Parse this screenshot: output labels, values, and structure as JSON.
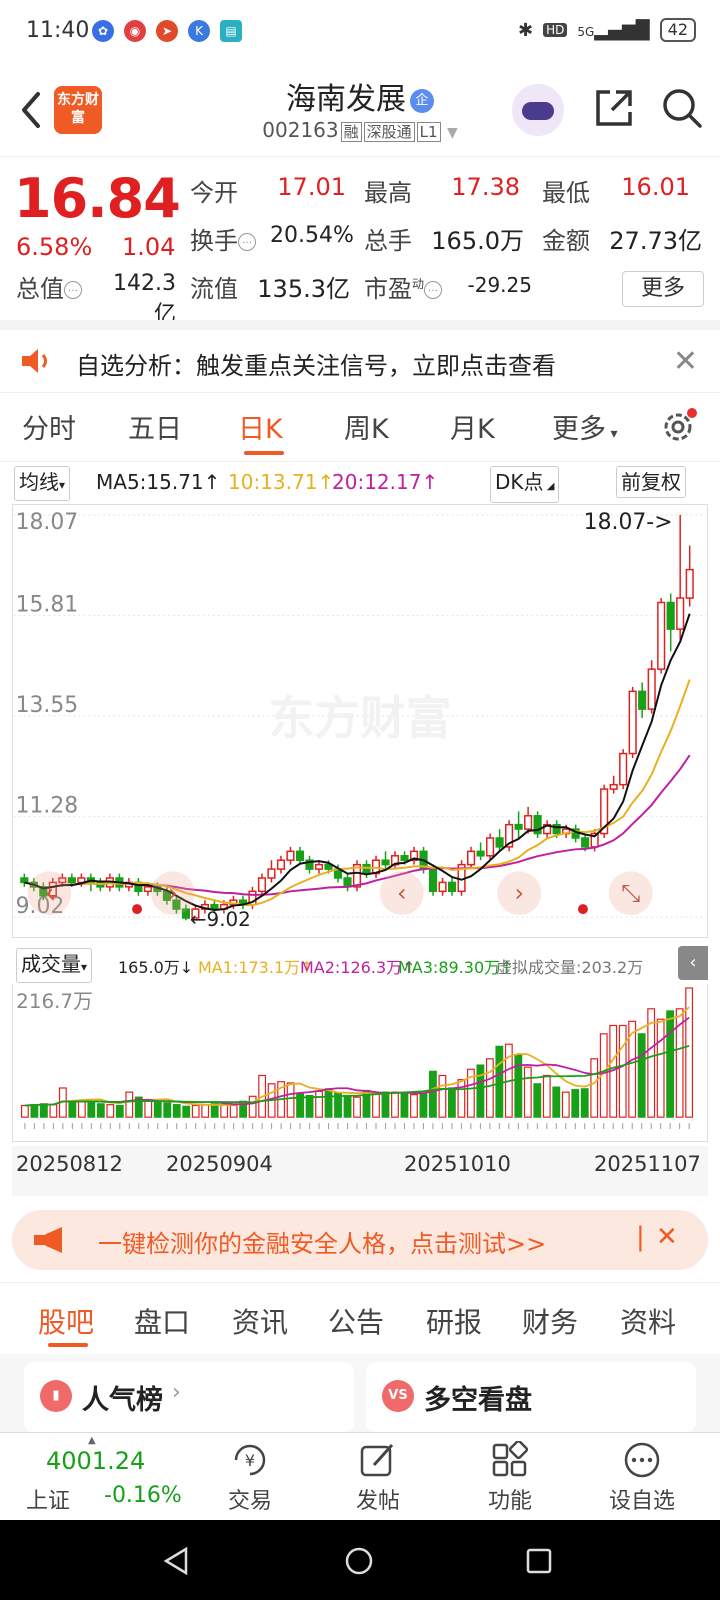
{
  "status": {
    "time": "11:40",
    "battery": "42",
    "network": "5G"
  },
  "header": {
    "title": "海南发展",
    "title_badge": "企",
    "code": "002163",
    "tags": [
      "融",
      "深股通",
      "L1"
    ],
    "logo_text": "东方财富"
  },
  "quote": {
    "price": "16.84",
    "pct": "6.58%",
    "change": "1.04",
    "open_label": "今开",
    "open": "17.01",
    "high_label": "最高",
    "high": "17.38",
    "low_label": "最低",
    "low": "16.01",
    "turnover_label": "换手",
    "turnover": "20.54%",
    "volume_label": "总手",
    "volume": "165.0万",
    "amount_label": "金额",
    "amount": "27.73亿",
    "mktcap_label": "总值",
    "mktcap": "142.3亿",
    "float_label": "流值",
    "float_cap": "135.3亿",
    "pe_label": "市盈",
    "pe_sup": "动",
    "pe": "-29.25",
    "more": "更多"
  },
  "notice": {
    "text": "自选分析：触发重点关注信号，立即点击查看"
  },
  "tabs": [
    "分时",
    "五日",
    "日K",
    "周K",
    "月K",
    "更多"
  ],
  "active_tab": "日K",
  "chart_toolbar": {
    "ma_select": "均线",
    "ma5": "MA5:15.71↑",
    "ma10": "10:13.71↑",
    "ma20": "20:12.17↑",
    "dk": "DK点",
    "adjust": "前复权"
  },
  "chart_data": {
    "type": "candlestick",
    "y_ticks": [
      "18.07",
      "15.81",
      "13.55",
      "11.28",
      "9.02"
    ],
    "ylim": [
      9.02,
      18.07
    ],
    "high_marker": "18.07->",
    "low_marker": "9.02",
    "watermark": "东方财富",
    "x_labels": [
      "20250812",
      "20250904",
      "20251010",
      "20251107"
    ],
    "colors": {
      "up": "#e02020",
      "down": "#18a018",
      "ma5": "#111111",
      "ma10": "#e8b020",
      "ma20": "#c020a0"
    },
    "candles": [
      [
        9.9,
        9.8,
        10.0,
        9.7
      ],
      [
        9.8,
        9.7,
        9.9,
        9.6
      ],
      [
        9.7,
        9.5,
        9.8,
        9.4
      ],
      [
        9.5,
        9.8,
        9.9,
        9.4
      ],
      [
        9.8,
        9.9,
        10.0,
        9.7
      ],
      [
        9.9,
        9.8,
        10.0,
        9.7
      ],
      [
        9.8,
        9.9,
        10.0,
        9.7
      ],
      [
        9.9,
        9.8,
        10.0,
        9.6
      ],
      [
        9.8,
        9.7,
        9.9,
        9.6
      ],
      [
        9.7,
        9.9,
        10.0,
        9.6
      ],
      [
        9.9,
        9.7,
        10.0,
        9.6
      ],
      [
        9.7,
        9.8,
        9.9,
        9.6
      ],
      [
        9.8,
        9.6,
        9.9,
        9.5
      ],
      [
        9.6,
        9.7,
        9.8,
        9.5
      ],
      [
        9.7,
        9.6,
        9.8,
        9.5
      ],
      [
        9.6,
        9.4,
        9.7,
        9.3
      ],
      [
        9.4,
        9.2,
        9.5,
        9.1
      ],
      [
        9.2,
        9.0,
        9.3,
        8.95
      ],
      [
        9.0,
        9.2,
        9.3,
        9.0
      ],
      [
        9.2,
        9.3,
        9.4,
        9.1
      ],
      [
        9.3,
        9.2,
        9.4,
        9.1
      ],
      [
        9.2,
        9.3,
        9.4,
        9.1
      ],
      [
        9.3,
        9.4,
        9.5,
        9.2
      ],
      [
        9.4,
        9.3,
        9.5,
        9.2
      ],
      [
        9.3,
        9.6,
        9.7,
        9.2
      ],
      [
        9.6,
        9.9,
        10.0,
        9.5
      ],
      [
        9.9,
        10.1,
        10.3,
        9.8
      ],
      [
        10.1,
        10.3,
        10.4,
        10.0
      ],
      [
        10.3,
        10.5,
        10.6,
        10.2
      ],
      [
        10.5,
        10.3,
        10.6,
        10.2
      ],
      [
        10.3,
        10.1,
        10.4,
        10.0
      ],
      [
        10.1,
        10.2,
        10.3,
        10.0
      ],
      [
        10.2,
        10.1,
        10.3,
        10.0
      ],
      [
        10.1,
        9.9,
        10.2,
        9.8
      ],
      [
        9.9,
        9.7,
        10.0,
        9.6
      ],
      [
        9.7,
        10.2,
        10.3,
        9.6
      ],
      [
        10.2,
        10.0,
        10.3,
        9.9
      ],
      [
        10.0,
        10.3,
        10.4,
        9.9
      ],
      [
        10.3,
        10.2,
        10.5,
        10.1
      ],
      [
        10.2,
        10.4,
        10.5,
        10.1
      ],
      [
        10.4,
        10.3,
        10.5,
        10.2
      ],
      [
        10.3,
        10.5,
        10.6,
        10.2
      ],
      [
        10.5,
        10.1,
        10.6,
        10.0
      ],
      [
        10.1,
        9.6,
        10.2,
        9.5
      ],
      [
        9.6,
        9.8,
        9.9,
        9.5
      ],
      [
        9.8,
        9.6,
        9.9,
        9.5
      ],
      [
        9.6,
        10.2,
        10.3,
        9.5
      ],
      [
        10.2,
        10.5,
        10.6,
        10.1
      ],
      [
        10.5,
        10.4,
        10.7,
        10.3
      ],
      [
        10.4,
        10.8,
        10.9,
        10.3
      ],
      [
        10.8,
        10.6,
        11.0,
        10.5
      ],
      [
        10.6,
        11.1,
        11.2,
        10.5
      ],
      [
        11.1,
        11.0,
        11.4,
        10.8
      ],
      [
        11.0,
        11.3,
        11.5,
        10.9
      ],
      [
        11.3,
        10.9,
        11.4,
        10.8
      ],
      [
        10.9,
        11.1,
        11.2,
        10.8
      ],
      [
        11.1,
        10.9,
        11.2,
        10.8
      ],
      [
        10.9,
        11.0,
        11.1,
        10.8
      ],
      [
        11.0,
        10.8,
        11.1,
        10.7
      ],
      [
        10.8,
        10.6,
        10.9,
        10.5
      ],
      [
        10.6,
        10.9,
        11.0,
        10.5
      ],
      [
        10.9,
        11.9,
        12.0,
        10.8
      ],
      [
        11.9,
        12.0,
        12.2,
        11.8
      ],
      [
        12.0,
        12.7,
        12.8,
        11.9
      ],
      [
        12.7,
        14.1,
        14.2,
        12.6
      ],
      [
        14.1,
        13.7,
        14.3,
        13.5
      ],
      [
        13.7,
        14.6,
        14.8,
        13.6
      ],
      [
        14.6,
        16.1,
        16.2,
        14.5
      ],
      [
        16.1,
        15.5,
        16.3,
        15.0
      ],
      [
        15.5,
        16.2,
        18.07,
        15.2
      ],
      [
        16.2,
        16.84,
        17.38,
        16.01
      ]
    ],
    "volume_axis_max": "216.7万",
    "volumes": [
      28,
      30,
      32,
      30,
      70,
      34,
      40,
      38,
      32,
      30,
      28,
      60,
      48,
      38,
      36,
      34,
      30,
      26,
      28,
      30,
      32,
      30,
      28,
      38,
      50,
      100,
      80,
      85,
      82,
      56,
      52,
      62,
      68,
      58,
      52,
      48,
      64,
      58,
      60,
      60,
      56,
      54,
      60,
      110,
      100,
      70,
      90,
      115,
      125,
      140,
      170,
      175,
      150,
      120,
      80,
      100,
      72,
      60,
      66,
      68,
      140,
      200,
      220,
      220,
      230,
      200,
      260,
      235,
      255,
      260,
      310
    ],
    "volume_up": [
      1,
      0,
      0,
      1,
      1,
      0,
      1,
      0,
      0,
      1,
      0,
      1,
      0,
      1,
      0,
      0,
      0,
      0,
      1,
      1,
      0,
      1,
      1,
      0,
      1,
      1,
      1,
      1,
      1,
      0,
      0,
      1,
      0,
      0,
      0,
      1,
      0,
      1,
      0,
      1,
      0,
      1,
      0,
      0,
      1,
      0,
      1,
      1,
      0,
      1,
      0,
      1,
      0,
      1,
      0,
      1,
      0,
      1,
      0,
      0,
      1,
      1,
      1,
      1,
      1,
      0,
      1,
      1,
      0,
      1,
      1
    ]
  },
  "volume_toolbar": {
    "select": "成交量",
    "vol": "165.0万↓",
    "ma1": "MA1:173.1万↑",
    "ma2": "MA2:126.3万↑",
    "ma3": "MA3:89.30万↑",
    "virtual": "虚拟成交量:203.2万"
  },
  "promo": {
    "text": "一键检测你的金融安全人格，点击测试>>"
  },
  "bottom_tabs": [
    "股吧",
    "盘口",
    "资讯",
    "公告",
    "研报",
    "财务",
    "资料"
  ],
  "cards": [
    {
      "label": "人气榜"
    },
    {
      "label": "多空看盘",
      "icon": "VS"
    }
  ],
  "index": {
    "value": "4001.24",
    "name": "上证",
    "pct": "-0.16%"
  },
  "bottom_nav": [
    "交易",
    "发帖",
    "功能",
    "设自选"
  ]
}
